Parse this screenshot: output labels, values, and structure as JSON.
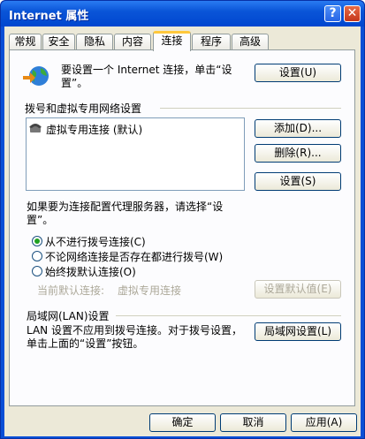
{
  "window": {
    "title": "Internet 属性",
    "help_glyph": "?",
    "close_glyph": "✕"
  },
  "tabs": [
    "常规",
    "安全",
    "隐私",
    "内容",
    "连接",
    "程序",
    "高级"
  ],
  "active_tab": "连接",
  "connect": {
    "setup_text": "要设置一个 Internet 连接，单击“设置”。",
    "setup_button": "设置(U)"
  },
  "dialup": {
    "heading": "拨号和虚拟专用网络设置",
    "list_item": "虚拟专用连接 (默认)",
    "add_button": "添加(D)...",
    "delete_button": "删除(R)...",
    "settings_button": "设置(S)",
    "proxy_hint": "如果要为连接配置代理服务器，请选择“设置”。",
    "options": [
      {
        "label": "从不进行拨号连接(C)",
        "checked": true
      },
      {
        "label": "不论网络连接是否存在都进行拨号(W)",
        "checked": false
      },
      {
        "label": "始终拨默认连接(O)",
        "checked": false
      }
    ],
    "current_default_label": "当前默认连接:",
    "current_default_value": "虚拟专用连接",
    "set_default_button": "设置默认值(E)"
  },
  "lan": {
    "heading": "局域网(LAN)设置",
    "text": "LAN 设置不应用到拨号连接。对于拨号设置，单击上面的“设置”按钮。",
    "button": "局域网设置(L)"
  },
  "footer": {
    "ok": "确定",
    "cancel": "取消",
    "apply": "应用(A)"
  },
  "colors": {
    "title_bar": "#0a55d8",
    "panel_bg": "#fcfcfe",
    "dialog_bg": "#ece9d8",
    "active_tab_accent": "#ffc83c"
  }
}
